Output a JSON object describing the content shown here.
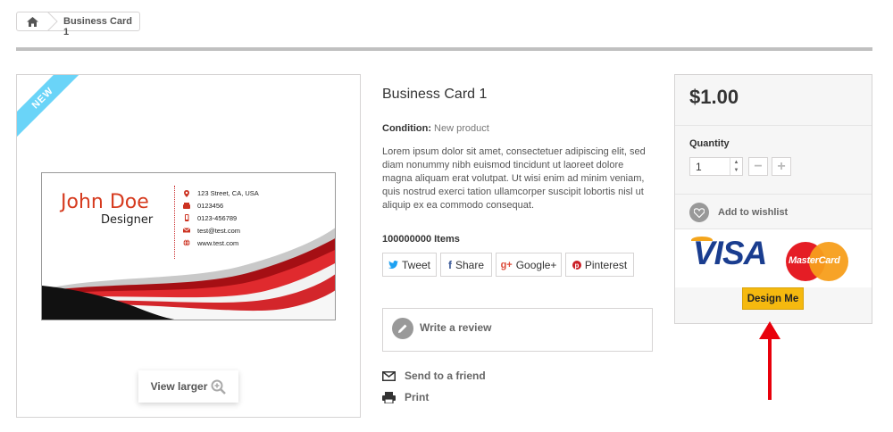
{
  "breadcrumb": {
    "home_icon": "home-icon",
    "current": "Business Card 1"
  },
  "image": {
    "ribbon": "NEW",
    "card": {
      "name": "John Doe",
      "title": "Designer",
      "info": [
        "123 Street, CA, USA",
        "0123456",
        "0123-456789",
        "test@test.com",
        "www.test.com"
      ],
      "colors": {
        "accent": "#d63b1f",
        "wave_red": "#d3262b",
        "wave_dark": "#111111"
      }
    },
    "view_larger": "View larger"
  },
  "product": {
    "title": "Business Card 1",
    "condition_label": "Condition:",
    "condition_value": "New product",
    "description": "Lorem ipsum dolor sit amet, consectetuer adipiscing elit, sed diam nonummy nibh euismod tincidunt ut laoreet dolore magna aliquam erat volutpat. Ut wisi enim ad minim veniam, quis nostrud exerci tation ullamcorper suscipit lobortis nisl ut aliquip ex ea commodo consequat.",
    "items_count": "100000000 Items",
    "social": {
      "tweet": "Tweet",
      "share": "Share",
      "google": "Google+",
      "pinterest": "Pinterest"
    },
    "review": "Write a review",
    "send_friend": "Send to a friend",
    "print": "Print"
  },
  "buybox": {
    "price": "$1.00",
    "quantity_label": "Quantity",
    "quantity_value": "1",
    "wishlist": "Add to wishlist",
    "visa": "VISA",
    "mastercard": "MasterCard",
    "design_button": "Design Me",
    "colors": {
      "design_button": "#f5b90f",
      "arrow": "#e8000b"
    }
  }
}
